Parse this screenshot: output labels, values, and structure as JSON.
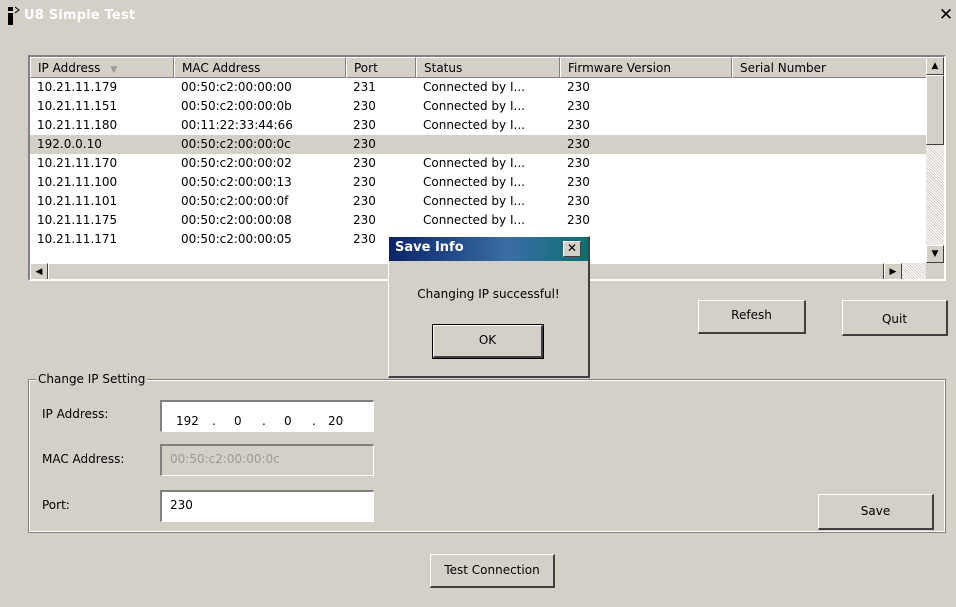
{
  "window": {
    "title": "U8 Simple Test",
    "close_glyph": "✕"
  },
  "table": {
    "columns": [
      "IP Address",
      "MAC Address",
      "Port",
      "Status",
      "Firmware Version",
      "Serial Number"
    ],
    "selected_index": 3,
    "rows": [
      [
        "10.21.11.179",
        "00:50:c2:00:00:00",
        "231",
        "Connected by I...",
        "230",
        ""
      ],
      [
        "10.21.11.151",
        "00:50:c2:00:00:0b",
        "230",
        "Connected by I...",
        "230",
        ""
      ],
      [
        "10.21.11.180",
        "00:11:22:33:44:66",
        "230",
        "Connected by I...",
        "230",
        ""
      ],
      [
        "192.0.0.10",
        "00:50:c2:00:00:0c",
        "230",
        "",
        "230",
        ""
      ],
      [
        "10.21.11.170",
        "00:50:c2:00:00:02",
        "230",
        "Connected by I...",
        "230",
        ""
      ],
      [
        "10.21.11.100",
        "00:50:c2:00:00:13",
        "230",
        "Connected by I...",
        "230",
        ""
      ],
      [
        "10.21.11.101",
        "00:50:c2:00:00:0f",
        "230",
        "Connected by I...",
        "230",
        ""
      ],
      [
        "10.21.11.175",
        "00:50:c2:00:00:08",
        "230",
        "Connected by I...",
        "230",
        ""
      ],
      [
        "10.21.11.171",
        "00:50:c2:00:00:05",
        "230",
        "",
        "",
        ""
      ]
    ]
  },
  "buttons": {
    "refresh": "Refesh",
    "quit": "Quit",
    "save": "Save",
    "test_connection": "Test Connection"
  },
  "change_ip": {
    "group_label": "Change IP Setting",
    "ip_label": "IP Address:",
    "ip_octets": [
      "192",
      "0",
      "0",
      "20"
    ],
    "mac_label": "MAC Address:",
    "mac_value": "00:50:c2:00:00:0c",
    "port_label": "Port:",
    "port_value": "230"
  },
  "dialog": {
    "title": "Save Info",
    "message": "Changing IP successful!",
    "ok": "OK",
    "close_glyph": "✕"
  },
  "icons": {
    "sort": "sort-down-icon",
    "app": "app-info-icon"
  }
}
